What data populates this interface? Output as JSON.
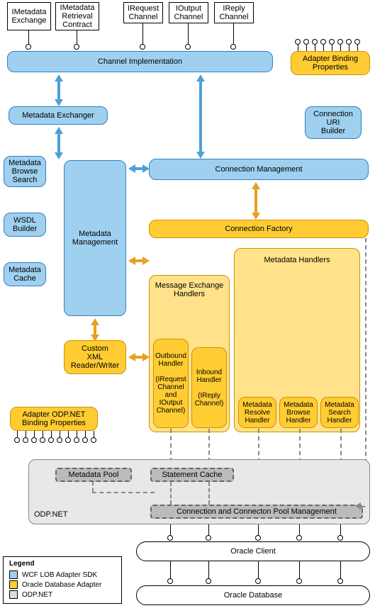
{
  "interfaces": {
    "imetadata_exchange": "IMetadata\nExchange",
    "imetadata_retrieval": "IMetadata\nRetrieval\nContract",
    "irequest_channel": "IRequest\nChannel",
    "ioutput_channel": "IOutput\nChannel",
    "ireply_channel": "IReply\nChannel"
  },
  "blue": {
    "channel_impl": "Channel Implementation",
    "metadata_exchanger": "Metadata Exchanger",
    "connection_uri_builder": "Connection\nURI\nBuilder",
    "metadata_browse_search": "Metadata\nBrowse\nSearch",
    "wsdl_builder": "WSDL\nBuilder",
    "metadata_cache": "Metadata\nCache",
    "metadata_management": "Metadata\nManagement",
    "connection_management": "Connection Management"
  },
  "orange": {
    "adapter_binding_props": "Adapter Binding\nProperties",
    "connection_factory": "Connection Factory",
    "metadata_handlers": "Metadata Handlers",
    "message_exchange_handlers": "Message Exchange\nHandlers",
    "custom_xml_rw": "Custom\nXML\nReader/Writer",
    "outbound_handler": "Outbound\nHandler\n\n(IRequest\nChannel\nand\nIOutput\nChannel)",
    "inbound_handler": "Inbound\nHandler\n\n(IReply\nChannel)",
    "metadata_resolve": "Metadata\nResolve\nHandler",
    "metadata_browse": "Metadata\nBrowse\nHandler",
    "metadata_search": "Metadata\nSearch\nHandler",
    "adapter_odpnet_binding": "Adapter ODP.NET\nBinding Properties"
  },
  "gray": {
    "odpnet_label": "ODP.NET",
    "metadata_pool": "Metadata Pool",
    "statement_cache": "Statement Cache",
    "conn_pool_mgmt": "Connection and Connecton Pool Management"
  },
  "white": {
    "oracle_client": "Oracle Client",
    "oracle_database": "Oracle Database"
  },
  "legend": {
    "title": "Legend",
    "wcf": "WCF LOB Adapter SDK",
    "oracle_adapter": "Oracle Database Adapter",
    "odpnet": "ODP.NET"
  }
}
